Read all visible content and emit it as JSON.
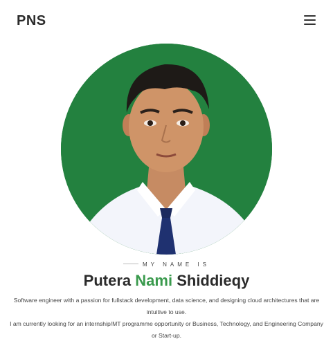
{
  "header": {
    "brand": "PNS",
    "menu_icon": "hamburger-menu-icon"
  },
  "hero": {
    "photo_alt": "profile-photo",
    "eyebrow": "MY NAME IS",
    "name_first": "Putera",
    "name_middle": "Nami",
    "name_last": "Shiddieqy",
    "bio_line1": "Software engineer with a passion for fullstack development, data science, and designing cloud architectures that are intuitive to use.",
    "bio_line2": "I am currently looking for an internship/MT programme opportunity or Business, Technology, and Engineering Company or Start-up."
  },
  "colors": {
    "accent": "#3a9a4d",
    "photo_background": "#1f7a3c",
    "text": "#2b2b2b"
  }
}
